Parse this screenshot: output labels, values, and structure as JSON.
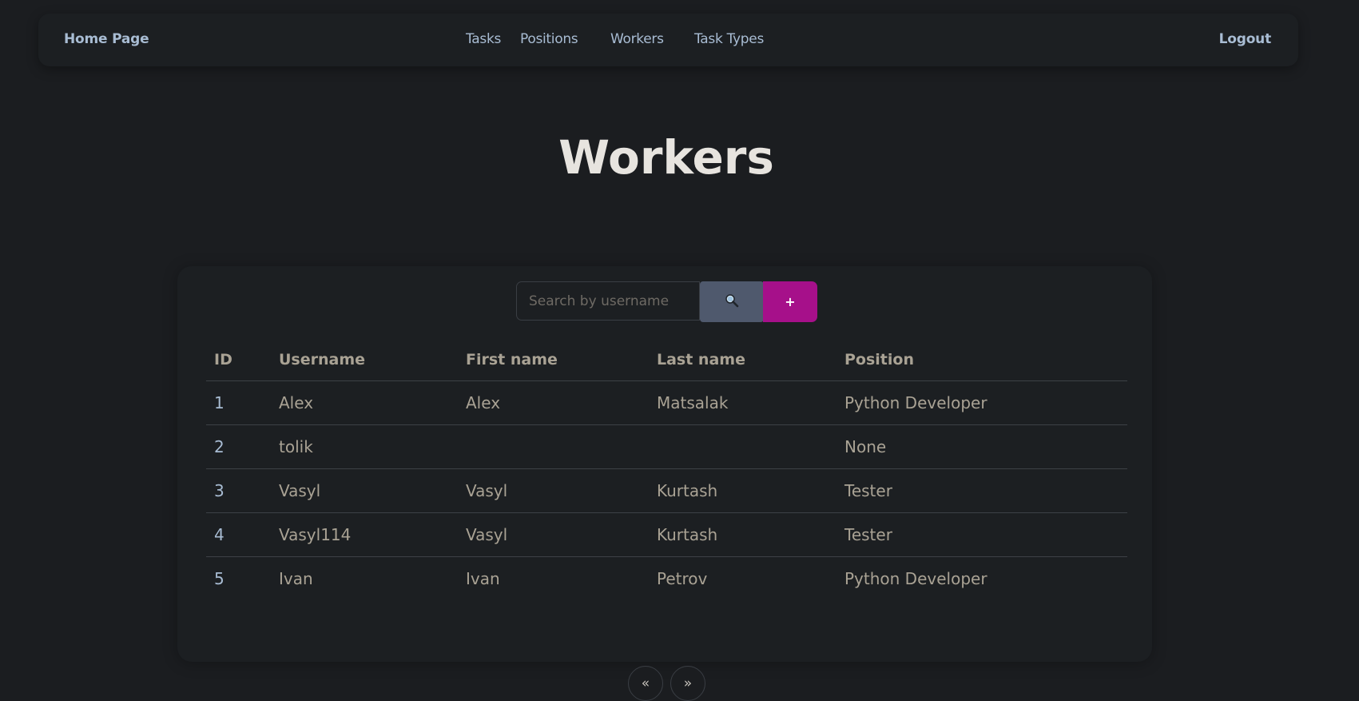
{
  "navbar": {
    "brand": "Home Page",
    "links": [
      "Tasks",
      "Positions",
      "Workers",
      "Task Types"
    ],
    "logout": "Logout"
  },
  "page": {
    "title": "Workers"
  },
  "search": {
    "placeholder": "Search by username",
    "search_icon": "magnifier-icon",
    "add_label": "+"
  },
  "table": {
    "headers": [
      "ID",
      "Username",
      "First name",
      "Last name",
      "Position"
    ],
    "rows": [
      [
        "1",
        "Alex",
        "Alex",
        "Matsalak",
        "Python Developer"
      ],
      [
        "2",
        "tolik",
        "",
        "",
        "None"
      ],
      [
        "3",
        "Vasyl",
        "Vasyl",
        "Kurtash",
        "Tester"
      ],
      [
        "4",
        "Vasyl114",
        "Vasyl",
        "Kurtash",
        "Tester"
      ],
      [
        "5",
        "Ivan",
        "Ivan",
        "Petrov",
        "Python Developer"
      ]
    ]
  },
  "pagination": {
    "prev": "«",
    "next": "»"
  },
  "colors": {
    "background": "#1b1d20",
    "link": "#a8bcd3",
    "search_button": "#4f596d",
    "add_button": "#a6108a"
  }
}
